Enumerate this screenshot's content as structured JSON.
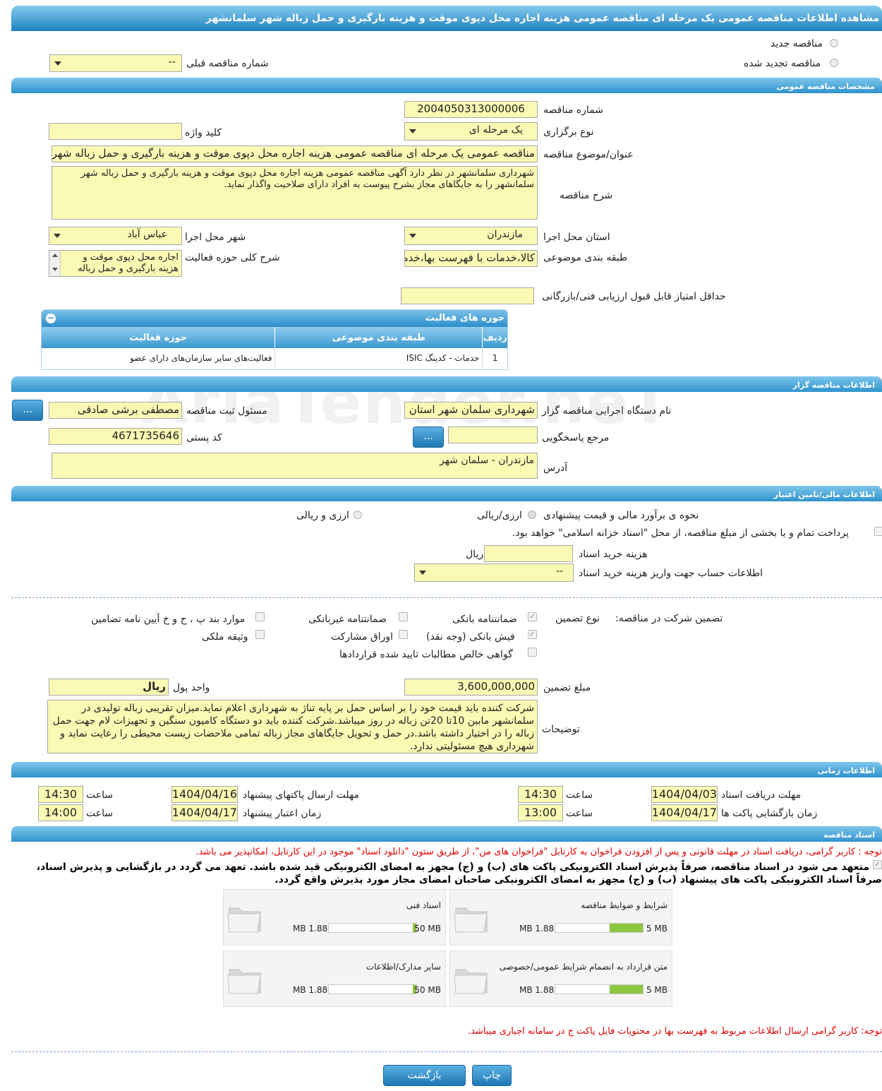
{
  "page_title": "مشاهده اطلاعات مناقصه عمومی یک مرحله ای مناقصه عمومی هزینه اجاره محل دپوی موقت و هزینه بارگیری و حمل زباله شهر سلمانشهر",
  "tender_type": {
    "new": "مناقصه جدید",
    "renewed": "مناقصه تجدید شده",
    "prev_number_label": "شماره مناقصه قبلی",
    "prev_number_value": "--"
  },
  "general": {
    "section_title": "مشخصات مناقصه عمومی",
    "number_label": "شماره مناقصه",
    "number": "2004050313000006",
    "keyword_label": "کلید واژه",
    "keyword": "",
    "holding_label": "نوع برگزاری",
    "holding": "یک مرحله ای",
    "subject_label": "عنوان/موضوع مناقصه",
    "subject": "مناقصه عمومی یک مرحله ای مناقصه عمومی هزینه اجاره محل دپوی موقت و هزینه بارگیری و حمل زباله شهر سلمانشهر",
    "desc_label": "شرح مناقصه",
    "desc": "شهرداری سلمانشهر در نظر دارد آگهی مناقصه عمومی هزینه اجاره محل دپوی موقت و هزینه بارگیری و حمل زباله شهر سلمانشهر را به جایگاهای مجاز بشرح پیوست به افراد دارای صلاحیت واگذار نماید.",
    "province_label": "استان محل اجرا",
    "province": "مازندران",
    "city_label": "شهر محل اجرا",
    "city": "عباس آباد",
    "category_label": "طبقه بندی موضوعی",
    "category": "کالا،خدمات با فهرست بها،خدمات",
    "scope_label": "شرح کلی حوزه فعالیت",
    "scope": "اجاره محل دپوی موقت و هزینه بارگیری و حمل زباله",
    "min_score_label": "حداقل امتیاز قابل قبول ارزیابی فنی/بازرگانی",
    "min_score": ""
  },
  "activity": {
    "title": "حوزه های فعالیت",
    "headers": [
      "ردیف",
      "طبقه بندی موضوعی",
      "حوزه فعالیت"
    ],
    "rows": [
      [
        "1",
        "خدمات - کدینگ ISIC",
        "فعالیت‌های سایر سازمان‌های دارای عضو"
      ]
    ]
  },
  "org": {
    "section_title": "اطلاعات مناقصه گزار",
    "device_label": "نام دستگاه اجرایی مناقصه گزار",
    "device": "شهرداری سلمان شهر استان مازندران",
    "registrar_label": "مسئول ثبت مناقصه",
    "registrar": "مصطفی برشی صادقی",
    "ref_label": "مرجع پاسخگویی",
    "ref": "",
    "postal_label": "کد پستی",
    "postal": "4671735646",
    "address_label": "آدرس",
    "address": "مازندران  - سلمان شهر",
    "dots": "..."
  },
  "finance": {
    "section_title": "اطلاعات مالی/تامین اعتبار",
    "estimate_label": "نحوه ی برآورد مالی و قیمت پیشنهادی",
    "rial": "ارزی/ریالی",
    "fx": "ارزی و ریالی",
    "treasury": "پرداخت تمام و یا بخشی از مبلغ مناقصه، از محل \"اسناد خزانه اسلامی\" خواهد بود.",
    "doc_cost_label": "هزینه خرید اسناد",
    "doc_cost": "",
    "doc_cost_unit": "ریال",
    "account_label": "اطلاعات حساب جهت واریز هزینه خرید اسناد",
    "account": "--"
  },
  "guarantee": {
    "label": "تضمین شرکت در مناقصه:",
    "type_label": "نوع تضمین",
    "bank": "ضمانتنامه بانکی",
    "nonbank": "ضمانتنامه غیربانکی",
    "cases": "موارد بند پ ، ح و خ آیین نامه تضامین",
    "cash": "فیش بانکی (وجه نقد)",
    "bonds": "اوراق مشارکت",
    "property": "وثیقه ملکی",
    "receivables": "گواهی خالص مطالبات تایید شده قراردادها",
    "amount_label": "مبلغ تضمین",
    "amount": "3,600,000,000",
    "currency_label": "واحد پول",
    "currency": "ریال",
    "notes_label": "توضیحات",
    "notes": "شرکت کننده باید قیمت خود را بر اساس حمل بر پایه تناژ به شهرداری اعلام نماید.میزان تقریبی زباله تولیدی در سلمانشهر مابین 10تا 20تن زباله در روز میباشد.شرکت کننده باید دو دستگاه کامیون سنگین و تجهیزات لام جهت حمل زباله را در اختیار داشته باشد.در حمل و تحویل جایگاهای مجاز زباله تمامی ملاحضات زیست محیطی را رعایت نماید و شهرداری هیچ مسئولیتی ندارد."
  },
  "timing": {
    "section_title": "اطلاعات زمانی",
    "receive_label": "مهلت دریافت اسناد",
    "receive_date": "1404/04/03",
    "receive_time": "14:30",
    "send_label": "مهلت ارسال پاکتهای پیشنهاد",
    "send_date": "1404/04/16",
    "send_time": "14:30",
    "open_label": "زمان بازگشایی پاکت ها",
    "open_date": "1404/04/17",
    "open_time": "13:00",
    "valid_label": "زمان اعتبار پیشنهاد",
    "valid_date": "1404/04/17",
    "valid_time": "14:00",
    "time_label": "ساعت"
  },
  "documents": {
    "section_title": "اسناد مناقصه",
    "note": "توجه : کاربر گرامی، دریافت اسناد در مهلت قانونی و پس از افزودن فراخوان به کارتابل \"فراخوان های من\"، از طریق ستون \"دانلود اسناد\" موجود در این کارتابل، امکانپذیر می باشد.",
    "commit1": "متعهد می شود در اسناد مناقصه، صرفاً پذیرش اسناد الکترونیکی پاکت های (ب) و (ج) مجهز به امضای الکترونیکی قید شده باشد. تعهد می گردد در بازگشایی و پذیرش اسناد،",
    "commit2": "صرفاً اسناد الکترونیکی پاکت های پیشنهاد (ب) و (ج) مجهز به امضای الکترونیکی صاحبان امضای مجاز مورد پذیرش واقع گردد.",
    "files": [
      {
        "name": "شرایط و ضوابط مناقصه",
        "used": "1.88 MB",
        "max": "5 MB",
        "fraction": 0.376
      },
      {
        "name": "اسناد فنی",
        "used": "1.88 MB",
        "max": "50 MB",
        "fraction": 0.038
      },
      {
        "name": "متن قرارداد به انضمام شرایط عمومی/خصوصی",
        "used": "1.88 MB",
        "max": "5 MB",
        "fraction": 0.376
      },
      {
        "name": "سایر مدارک/اطلاعات",
        "used": "1.88 MB",
        "max": "50 MB",
        "fraction": 0.038
      }
    ],
    "note2": "توجه: کاربر گرامی ارسال اطلاعات مربوط به فهرست بها در محتویات فایل پاکت ج در سامانه اجباری میباشد."
  },
  "buttons": {
    "print": "چاپ",
    "back": "بازگشت"
  },
  "watermark": "AriaTender.neT"
}
